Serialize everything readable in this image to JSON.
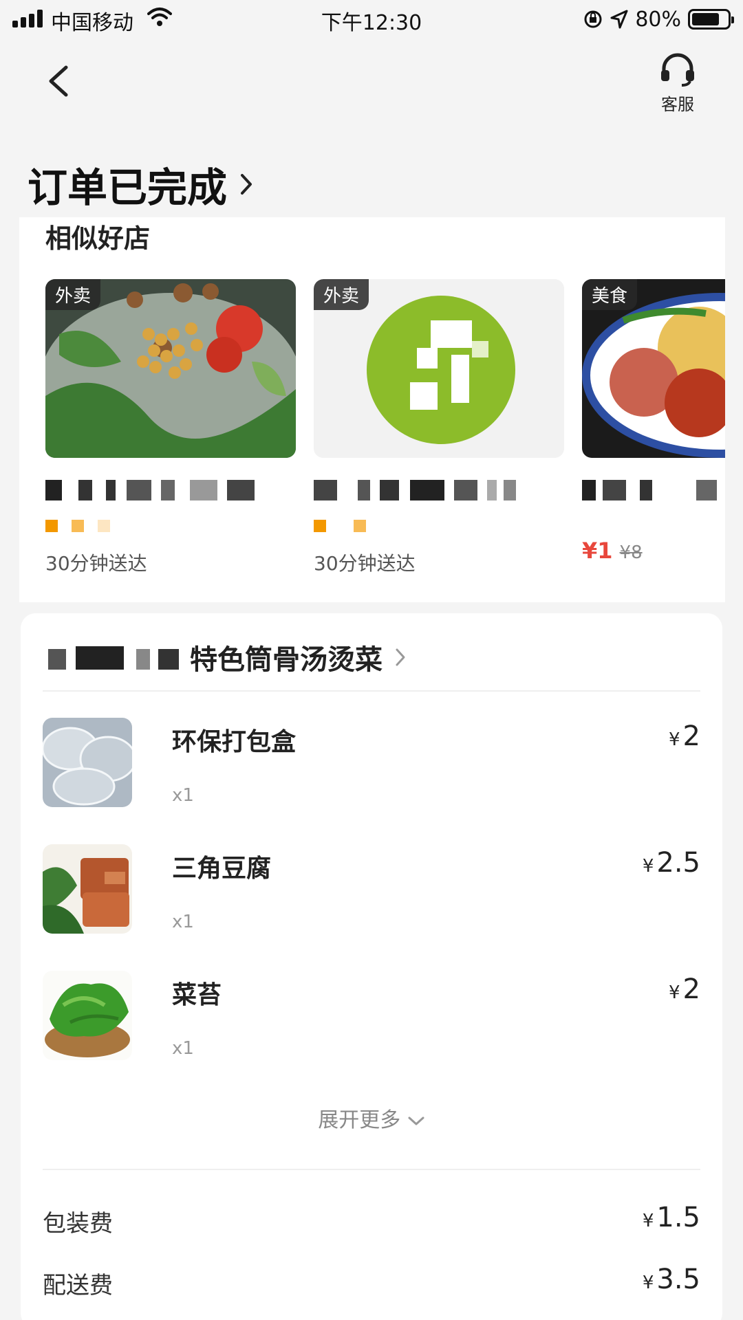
{
  "status_bar": {
    "carrier": "中国移动",
    "time": "下午12:30",
    "battery": "80%",
    "battery_level": 0.8
  },
  "header": {
    "customer_service_label": "客服",
    "order_status": "订单已完成"
  },
  "similar_stores": {
    "title": "相似好店",
    "stores": [
      {
        "tag": "外卖",
        "eta": "30分钟送达"
      },
      {
        "tag": "外卖",
        "eta": "30分钟送达"
      },
      {
        "tag": "美食",
        "price_now": "¥1",
        "price_old": "¥8"
      }
    ]
  },
  "order": {
    "shop_name_suffix": "特色筒骨汤烫菜",
    "items": [
      {
        "name": "环保打包盒",
        "qty": "x1",
        "yen": "¥",
        "price": "2"
      },
      {
        "name": "三角豆腐",
        "qty": "x1",
        "yen": "¥",
        "price": "2.5"
      },
      {
        "name": "菜苔",
        "qty": "x1",
        "yen": "¥",
        "price": "2"
      }
    ],
    "expand_label": "展开更多",
    "fees": [
      {
        "label": "包装费",
        "yen": "¥",
        "value": "1.5"
      },
      {
        "label": "配送费",
        "yen": "¥",
        "value": "3.5"
      }
    ]
  }
}
